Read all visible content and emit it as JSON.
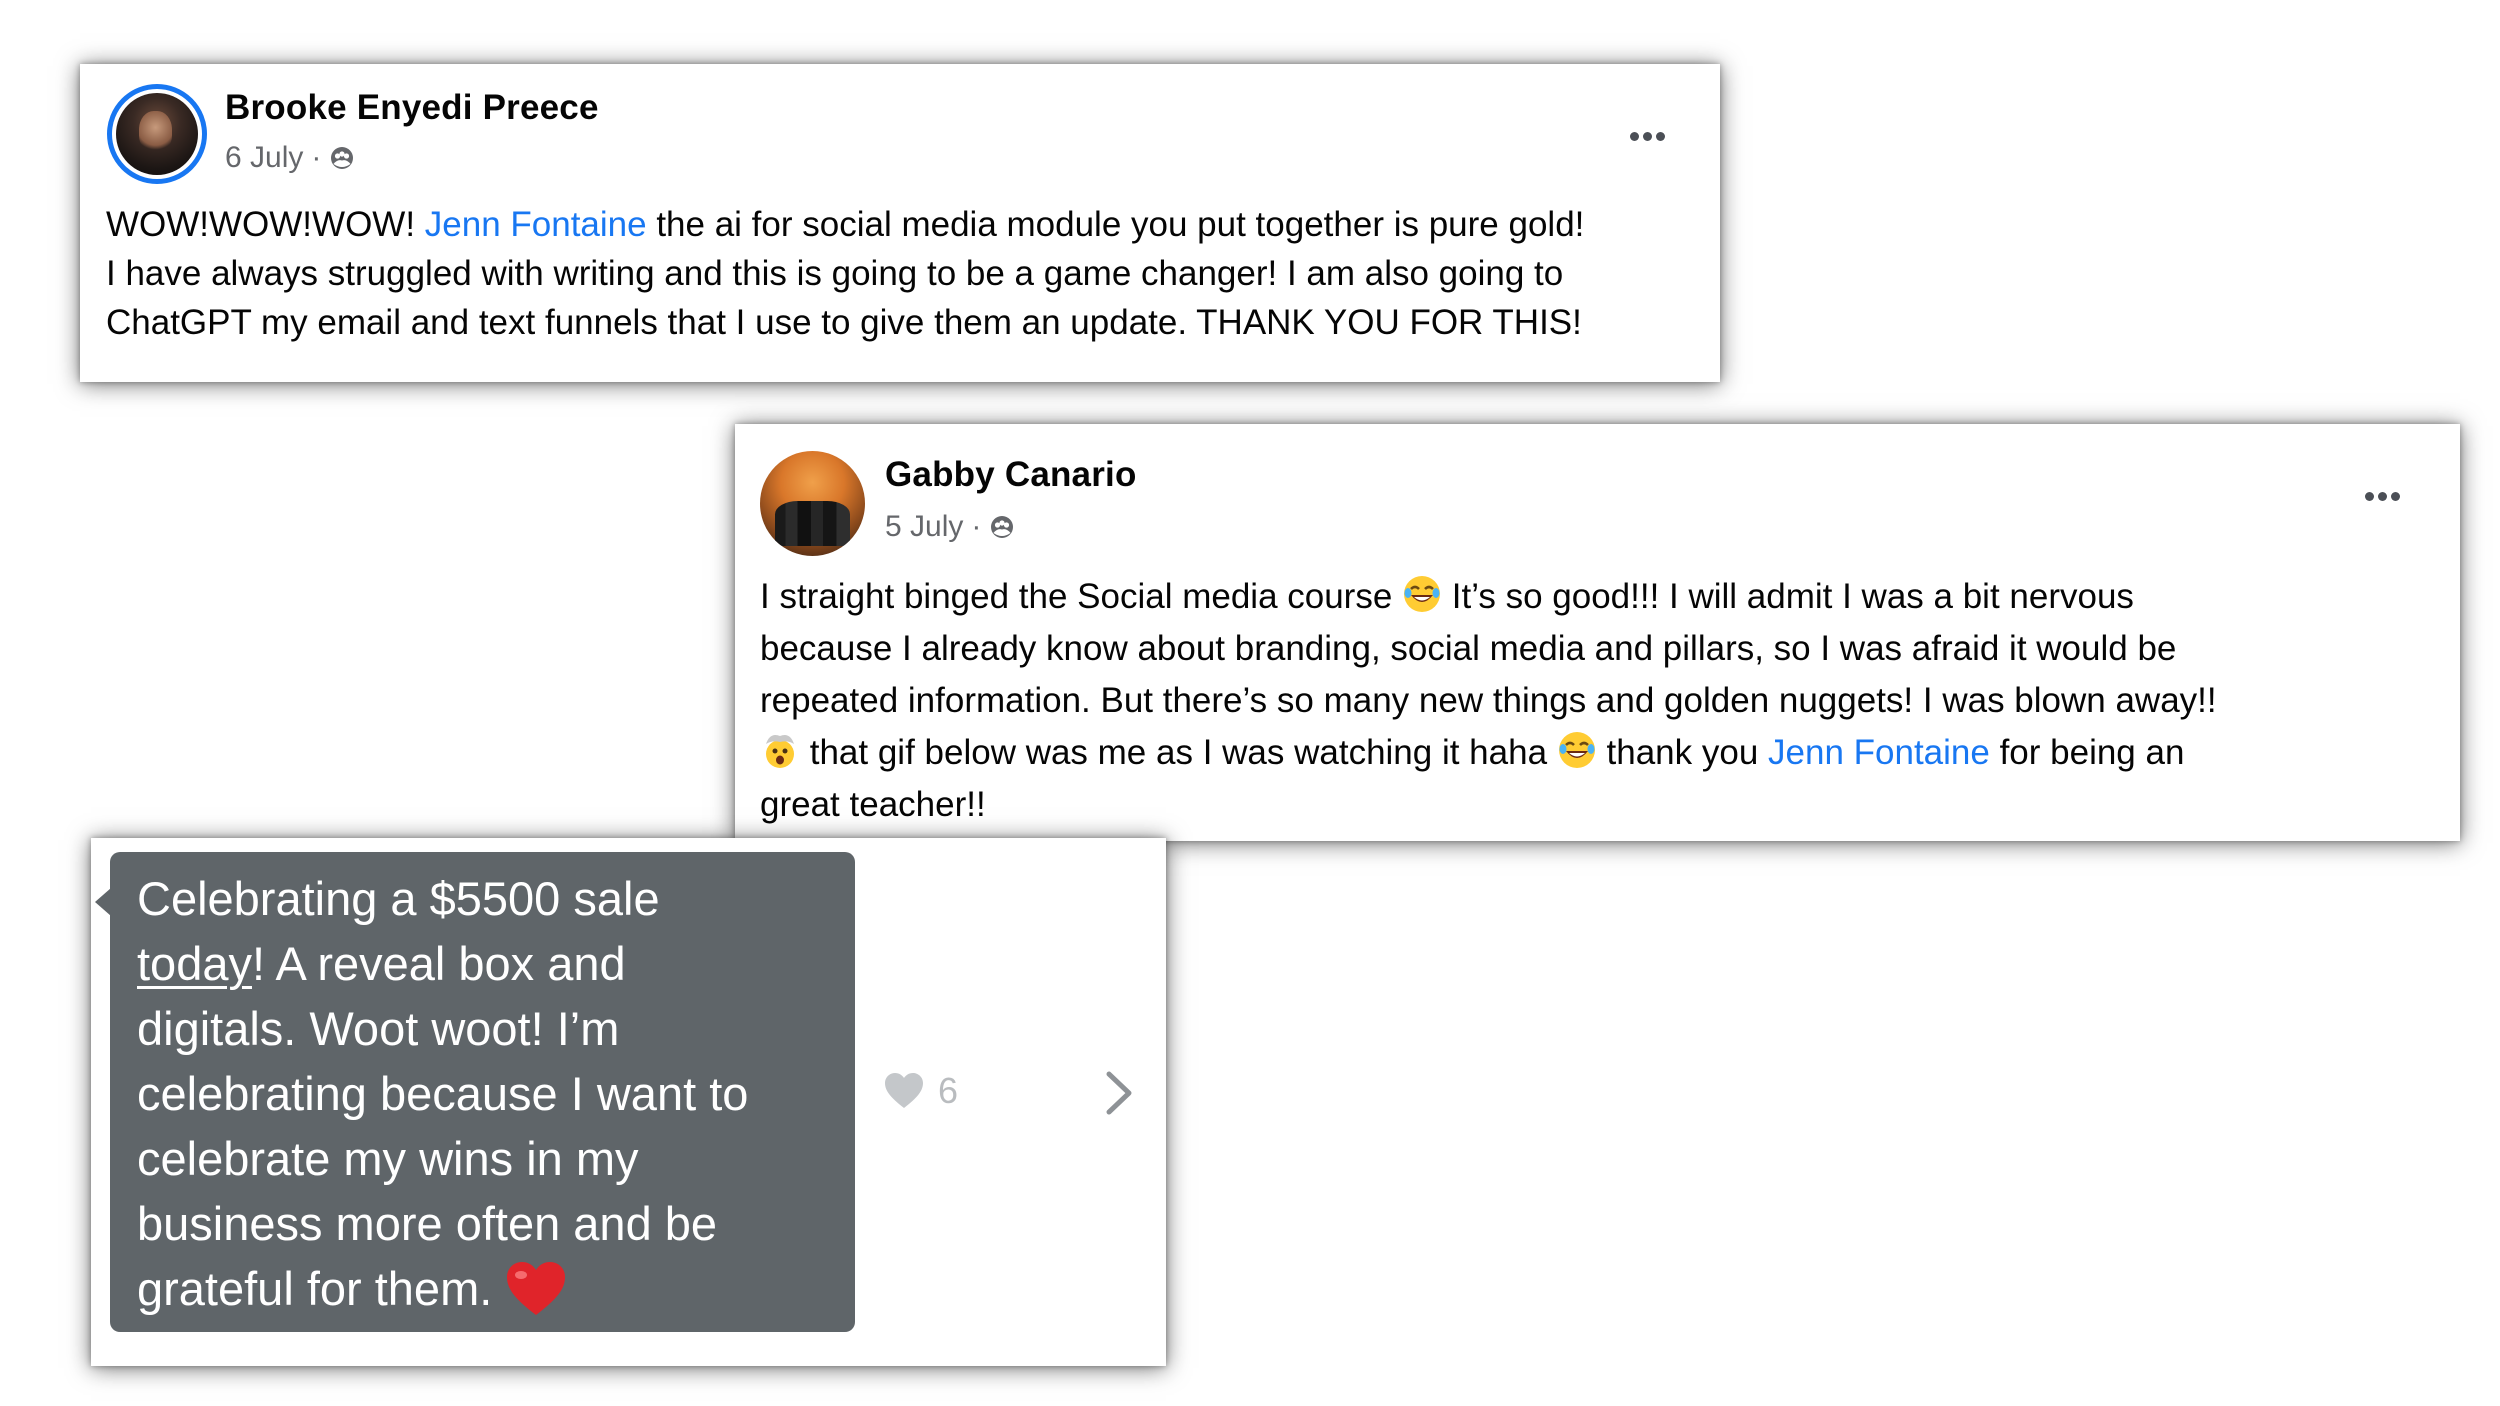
{
  "posts": [
    {
      "author": "Brooke Enyedi Preece",
      "date": "6 July",
      "separator": "·",
      "privacy_icon": "group-icon",
      "body_part1": "WOW!WOW!WOW! ",
      "mention": "Jenn Fontaine",
      "body_line1_rest": " the ai for social media module you put together is pure gold!",
      "body_line2": "I have always struggled with writing and this is going to be a game changer! I am also going to",
      "body_line3": "ChatGPT my email and text funnels that I use to give them an update. THANK YOU FOR THIS!"
    },
    {
      "author": "Gabby Canario",
      "date": "5 July",
      "separator": "·",
      "privacy_icon": "group-icon",
      "line1_a": "I straight binged the Social media course ",
      "line1_b": " It’s so good!!! I will admit I was a bit nervous",
      "line2": "because I already know about branding, social media and pillars, so I was afraid it would be",
      "line3": "repeated information. But there’s so many new things and golden nuggets! I was blown away!!",
      "line4_a": "  that gif below was me as I was watching it haha ",
      "line4_b": " thank you ",
      "mention": "Jenn Fontaine",
      "line4_c": " for being an",
      "line5": "great teacher!!"
    }
  ],
  "message": {
    "line1": "Celebrating a $5500 sale",
    "underlined_word": "today",
    "line2_rest": "! A reveal box and",
    "line3": "digitals. Woot woot! I’m",
    "line4": "celebrating because I want to",
    "line5": "celebrate my wins in my",
    "line6": "business more often and be",
    "line7": "grateful for them. ",
    "heart_emoji": "heart-emoji",
    "likes": "6",
    "like_icon": "heart-icon",
    "chevron_icon": "chevron-right-icon"
  },
  "colors": {
    "mention": "#1877f2",
    "avatar_ring": "#1877f2",
    "bubble": "#5f6569",
    "meta": "#65676b"
  }
}
